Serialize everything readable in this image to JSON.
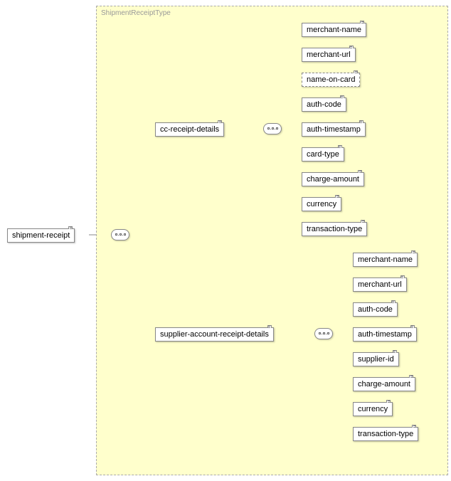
{
  "type_label": "ShipmentReceiptType",
  "root": "shipment-receipt",
  "branches": {
    "cc": {
      "label": "cc-receipt-details",
      "children": [
        "merchant-name",
        "merchant-url",
        "name-on-card",
        "auth-code",
        "auth-timestamp",
        "card-type",
        "charge-amount",
        "currency",
        "transaction-type"
      ]
    },
    "supplier": {
      "label": "supplier-account-receipt-details",
      "children": [
        "merchant-name",
        "merchant-url",
        "auth-code",
        "auth-timestamp",
        "supplier-id",
        "charge-amount",
        "currency",
        "transaction-type"
      ]
    }
  }
}
